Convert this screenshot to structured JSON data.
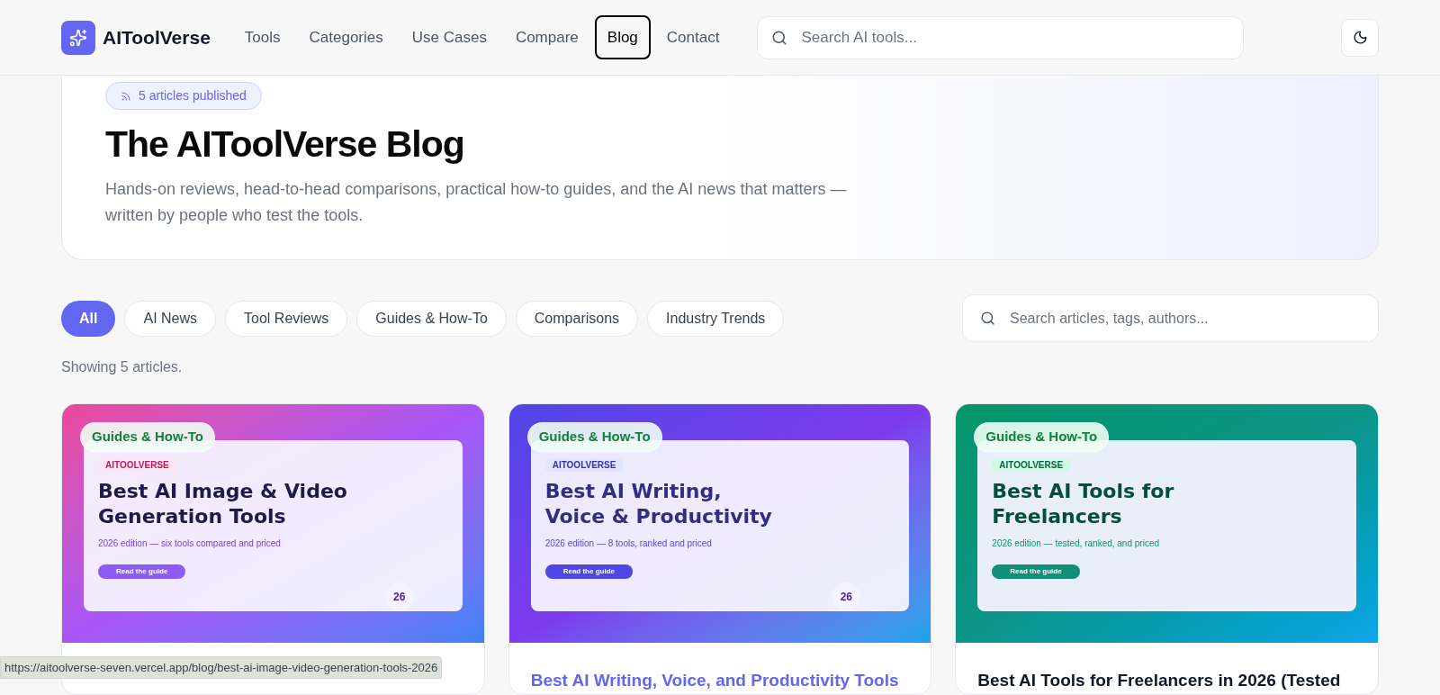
{
  "nav": {
    "brand": "AIToolVerse",
    "links": [
      {
        "label": "Tools",
        "selected": false
      },
      {
        "label": "Categories",
        "selected": false
      },
      {
        "label": "Use Cases",
        "selected": false
      },
      {
        "label": "Compare",
        "selected": false
      },
      {
        "label": "Blog",
        "selected": true
      },
      {
        "label": "Contact",
        "selected": false
      }
    ],
    "search": {
      "placeholder": "Search AI tools..."
    }
  },
  "hero": {
    "badge": "5 articles published",
    "title": "The AIToolVerse Blog",
    "description": "Hands-on reviews, head-to-head comparisons, practical how-to guides, and the AI news that matters — written by people who test the tools."
  },
  "filters": [
    {
      "label": "All",
      "selected": true
    },
    {
      "label": "AI News",
      "selected": false
    },
    {
      "label": "Tool Reviews",
      "selected": false
    },
    {
      "label": "Guides & How-To",
      "selected": false
    },
    {
      "label": "Comparisons",
      "selected": false
    },
    {
      "label": "Industry Trends",
      "selected": false
    }
  ],
  "article_search": {
    "placeholder": "Search articles, tags, authors..."
  },
  "result_count": "Showing 5 articles.",
  "articles": [
    {
      "kind": "violet",
      "category": "Guides & How-To",
      "image": {
        "brand": "AITOOLVERSE",
        "headline_lines": [
          "Best AI Image & Video",
          "Generation Tools"
        ],
        "subtitle": "2026 edition — six tools compared and priced",
        "button": "Read the guide",
        "number": "26"
      }
    },
    {
      "kind": "indigo",
      "category": "Guides & How-To",
      "image": {
        "brand": "AITOOLVERSE",
        "headline_lines": [
          "Best AI Writing,",
          "Voice & Productivity"
        ],
        "subtitle": "2026 edition — 8 tools, ranked and priced",
        "button": "Read the guide",
        "number": "26"
      },
      "title": "Best AI Writing, Voice, and Productivity Tools",
      "hovered": true
    },
    {
      "kind": "green",
      "category": "Guides & How-To",
      "image": {
        "brand": "AITOOLVERSE",
        "headline_lines": [
          "Best AI Tools for",
          "Freelancers"
        ],
        "subtitle": "2026 edition — tested, ranked, and priced",
        "button": "Read the guide"
      },
      "title": "Best AI Tools for Freelancers in 2026 (Tested",
      "hovered": false
    }
  ],
  "status_bar": {
    "url": "https://aitoolverse-seven.vercel.app/blog/best-ai-image-video-generation-tools-2026"
  }
}
